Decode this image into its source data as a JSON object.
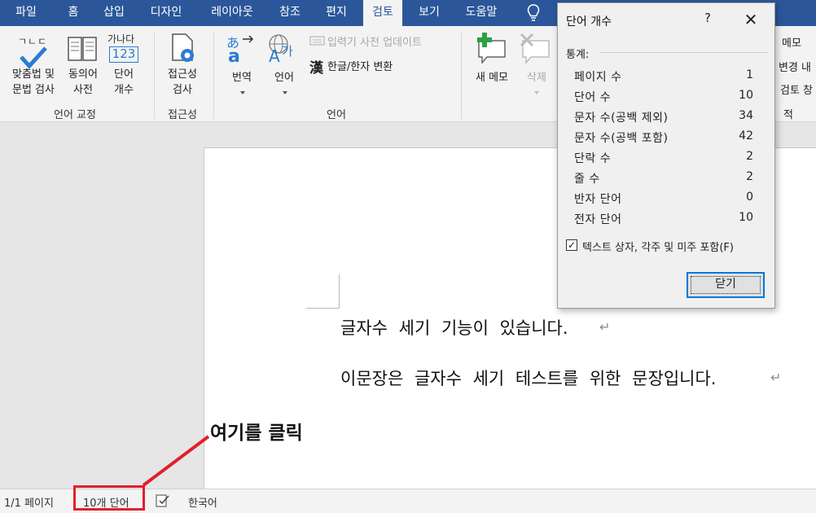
{
  "tabs": [
    "파일",
    "홈",
    "삽입",
    "디자인",
    "레이아웃",
    "참조",
    "편지",
    "검토",
    "보기",
    "도움말"
  ],
  "active_tab": "검토",
  "colors": {
    "ribbon_blue": "#2b579a",
    "highlight_red": "#e0202c",
    "focus_blue": "#0078d7"
  },
  "ribbon": {
    "spell_label_1": "맞춤법 및",
    "spell_label_2": "문법 검사",
    "thesaurus_label_1": "동의어",
    "thesaurus_label_2": "사전",
    "wordcount_label_1": "단어",
    "wordcount_label_2": "개수",
    "wordcount_icon_top": "가나다",
    "wordcount_icon_num": "123",
    "spell_icon_text": "ㄱㄴㄷ",
    "proofing_group": "언어 교정",
    "access_label_1": "접근성",
    "access_label_2": "검사",
    "access_group": "접근성",
    "translate_label": "번역",
    "language_label": "언어",
    "ime_update": "입력기 사전 업데이트",
    "hanja_icon": "漢",
    "hanja_convert": "한글/한자 변환",
    "language_group": "언어",
    "new_comment": "새 메모",
    "delete_comment": "삭제",
    "right_partial_1": "메모 ",
    "right_partial_2": "변경 내",
    "right_partial_3": "검토 창",
    "right_partial_4": "적"
  },
  "document": {
    "line1": "글자수 세기 기능이 있습니다.",
    "line2": "이문장은 글자수 세기 테스트를 위한 문장입니다.",
    "para_mark": "↵"
  },
  "dialog": {
    "title": "단어 개수",
    "help": "?",
    "close": "✕",
    "stats_label": "통계:",
    "stats": [
      {
        "name": "페이지 수",
        "value": "1"
      },
      {
        "name": "단어 수",
        "value": "10"
      },
      {
        "name": "문자 수(공백 제외)",
        "value": "34"
      },
      {
        "name": "문자 수(공백 포함)",
        "value": "42"
      },
      {
        "name": "단락 수",
        "value": "2"
      },
      {
        "name": "줄 수",
        "value": "2"
      },
      {
        "name": "반자 단어",
        "value": "0"
      },
      {
        "name": "전자 단어",
        "value": "10"
      }
    ],
    "checkbox_label": "텍스트 상자, 각주 및 미주 포함(F)",
    "checkbox_checked": true,
    "close_button": "닫기"
  },
  "statusbar": {
    "page": "1/1 페이지",
    "words": "10개 단어",
    "language": "한국어"
  },
  "annotation": {
    "callout": "여기를 클릭"
  }
}
